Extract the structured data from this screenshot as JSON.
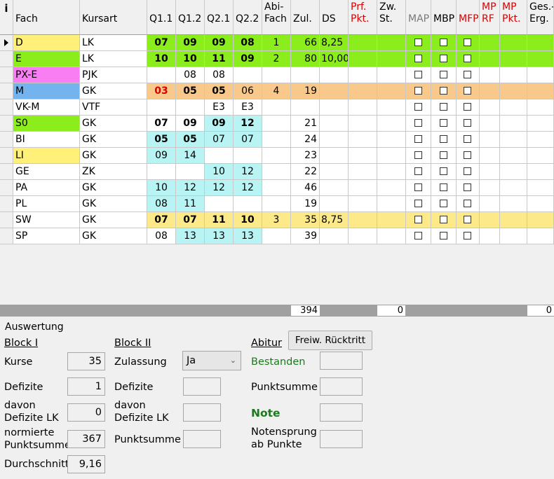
{
  "headers": [
    "i",
    "Fach",
    "Kursart",
    "Q1.1",
    "Q1.2",
    "Q2.1",
    "Q2.2",
    "Abi-\nFach",
    "Zul.",
    "DS",
    "Prf.\nPkt.",
    "Zw.\nSt.",
    "MAP",
    "MBP",
    "MFP",
    "MP\nRF",
    "MP\nPkt.",
    "Ges.-\nErg."
  ],
  "header_colors": {
    "Prf. Pkt.": "#d80000",
    "MAP": "#7a7a7a",
    "MFP": "#d80000",
    "MP RF": "#d80000",
    "MP Pkt.": "#d80000"
  },
  "colors": {
    "cyan": "#b8f4f4",
    "lightgreen": "#8ced1c",
    "yellow": "#fff07a",
    "magenta": "#fa7ef3",
    "blue": "#74b4ee",
    "orange": "#f8c98a",
    "paleyellow": "#fce98a",
    "red": "#d80000"
  },
  "rows": [
    {
      "fach": "D",
      "kurs": "LK",
      "q": [
        "07",
        "09",
        "09",
        "08"
      ],
      "abi": "1",
      "zul": "66",
      "ds": "8,25",
      "fach_color": "yellow",
      "row_color": "lightgreen",
      "bold": [
        true,
        true,
        true,
        true
      ],
      "current": true
    },
    {
      "fach": "E",
      "kurs": "LK",
      "q": [
        "10",
        "10",
        "11",
        "09"
      ],
      "abi": "2",
      "zul": "80",
      "ds": "10,00",
      "fach_color": "lightgreen",
      "row_color": "lightgreen",
      "bold": [
        true,
        true,
        true,
        true
      ]
    },
    {
      "fach": "PX-E",
      "kurs": "PJK",
      "q": [
        "",
        "08",
        "08",
        ""
      ],
      "abi": "",
      "zul": "",
      "ds": "",
      "fach_color": "magenta",
      "row_color": "",
      "bold": [
        false,
        false,
        false,
        false
      ],
      "q_bg": [
        "white",
        "white",
        "white",
        "white"
      ]
    },
    {
      "fach": "M",
      "kurs": "GK",
      "q": [
        "03",
        "05",
        "05",
        "06"
      ],
      "abi": "4",
      "zul": "19",
      "ds": "",
      "fach_color": "blue",
      "row_color": "orange",
      "bold": [
        true,
        true,
        true,
        false
      ],
      "q_red": [
        true,
        false,
        false,
        false
      ]
    },
    {
      "fach": "VK-M",
      "kurs": "VTF",
      "q": [
        "",
        "",
        "E3",
        "E3"
      ],
      "abi": "",
      "zul": "",
      "ds": "",
      "fach_color": "",
      "row_color": "",
      "bold": [
        false,
        false,
        false,
        false
      ],
      "q_bg": [
        "white",
        "white",
        "white",
        "white"
      ]
    },
    {
      "fach": "S0",
      "kurs": "GK",
      "q": [
        "07",
        "09",
        "09",
        "12"
      ],
      "abi": "",
      "zul": "21",
      "ds": "",
      "fach_color": "lightgreen",
      "row_color": "",
      "bold": [
        true,
        true,
        true,
        true
      ],
      "q_bg": [
        "white",
        "white",
        "cyan",
        "cyan"
      ]
    },
    {
      "fach": "BI",
      "kurs": "GK",
      "q": [
        "05",
        "05",
        "07",
        "07"
      ],
      "abi": "",
      "zul": "24",
      "ds": "",
      "fach_color": "",
      "row_color": "",
      "bold": [
        true,
        true,
        false,
        false
      ]
    },
    {
      "fach": "LI",
      "kurs": "GK",
      "q": [
        "09",
        "14",
        "",
        ""
      ],
      "abi": "",
      "zul": "23",
      "ds": "",
      "fach_color": "yellow",
      "row_color": "",
      "bold": [
        false,
        false,
        false,
        false
      ],
      "q_bg": [
        "cyan",
        "cyan",
        "white",
        "white"
      ]
    },
    {
      "fach": "GE",
      "kurs": "ZK",
      "q": [
        "",
        "",
        "10",
        "12"
      ],
      "abi": "",
      "zul": "22",
      "ds": "",
      "fach_color": "",
      "row_color": "",
      "bold": [
        false,
        false,
        false,
        false
      ],
      "q_bg": [
        "white",
        "white",
        "cyan",
        "cyan"
      ]
    },
    {
      "fach": "PA",
      "kurs": "GK",
      "q": [
        "10",
        "12",
        "12",
        "12"
      ],
      "abi": "",
      "zul": "46",
      "ds": "",
      "fach_color": "",
      "row_color": "",
      "bold": [
        false,
        false,
        false,
        false
      ]
    },
    {
      "fach": "PL",
      "kurs": "GK",
      "q": [
        "08",
        "11",
        "",
        ""
      ],
      "abi": "",
      "zul": "19",
      "ds": "",
      "fach_color": "",
      "row_color": "",
      "bold": [
        false,
        false,
        false,
        false
      ],
      "q_bg": [
        "cyan",
        "cyan",
        "white",
        "white"
      ]
    },
    {
      "fach": "SW",
      "kurs": "GK",
      "q": [
        "07",
        "07",
        "11",
        "10"
      ],
      "abi": "3",
      "zul": "35",
      "ds": "8,75",
      "fach_color": "",
      "row_color": "paleyellow",
      "bold": [
        true,
        true,
        true,
        true
      ],
      "q_bg": [
        "cyan",
        "cyan",
        "cyan",
        "cyan"
      ]
    },
    {
      "fach": "SP",
      "kurs": "GK",
      "q": [
        "08",
        "13",
        "13",
        "13"
      ],
      "abi": "",
      "zul": "39",
      "ds": "",
      "fach_color": "",
      "row_color": "",
      "bold": [
        false,
        false,
        false,
        false
      ],
      "q_bg": [
        "white",
        "cyan",
        "cyan",
        "cyan"
      ]
    }
  ],
  "sums": {
    "zul": "394",
    "zw": "0",
    "ges": "0"
  },
  "auswertung": {
    "title": "Auswertung",
    "block1": {
      "title": "Block I",
      "kurse_label": "Kurse",
      "kurse": "35",
      "defizite_label": "Defizite",
      "defizite": "1",
      "davon_label": "davon\nDefizite LK",
      "davon": "0",
      "norm_label": "normierte\nPunktsumme",
      "norm": "367",
      "durch_label": "Durchschnitt",
      "durch": "9,16"
    },
    "block2": {
      "title": "Block II",
      "zulassung_label": "Zulassung",
      "zulassung": "Ja",
      "defizite_label": "Defizite",
      "davon_label": "davon\nDefizite LK",
      "punktsumme_label": "Punktsumme"
    },
    "abitur": {
      "title": "Abitur",
      "button": "Freiw. Rücktritt",
      "bestanden_label": "Bestanden",
      "punktsumme_label": "Punktsumme",
      "note_label": "Note",
      "notensprung_label": "Notensprung\nab Punkte"
    }
  }
}
